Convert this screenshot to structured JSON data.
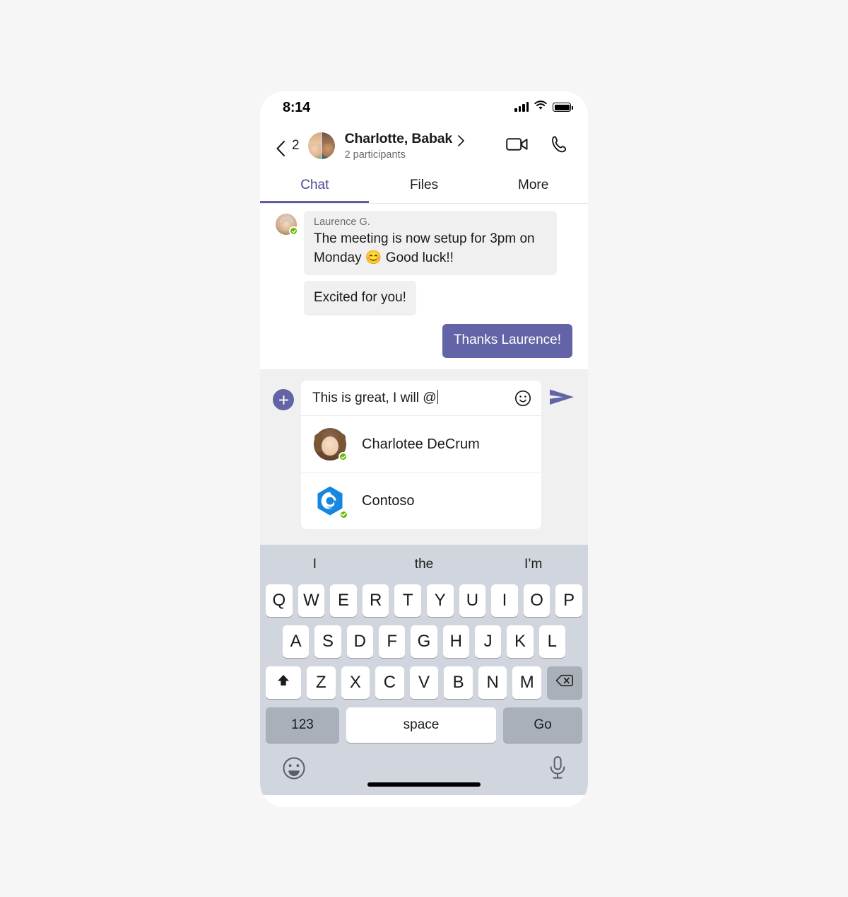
{
  "status_bar": {
    "time": "8:14",
    "signal_icon": "cellular-signal-icon",
    "wifi_icon": "wifi-icon",
    "battery_icon": "battery-full-icon"
  },
  "header": {
    "back_icon": "chevron-left-icon",
    "back_count": "2",
    "avatar_name": "group-avatar",
    "title": "Charlotte, Babak",
    "title_chevron_icon": "chevron-right-icon",
    "subtitle": "2 participants",
    "video_call_icon": "video-camera-icon",
    "audio_call_icon": "phone-icon"
  },
  "tabs": {
    "active_index": 0,
    "items": [
      {
        "label": "Chat"
      },
      {
        "label": "Files"
      },
      {
        "label": "More"
      }
    ]
  },
  "messages": [
    {
      "type": "incoming",
      "sender": "Laurence G.",
      "text": "The meeting is now setup for 3pm on Monday 😊 Good luck!!",
      "avatar": "laurence-avatar",
      "presence": "available"
    },
    {
      "type": "incoming",
      "sender": "",
      "text": "Excited for you!"
    },
    {
      "type": "outgoing",
      "text": "Thanks Laurence!"
    }
  ],
  "compose": {
    "add_icon": "plus-icon",
    "input_value": "This is great, I will @",
    "input_placeholder": "Type a message",
    "emoji_icon": "smiley-face-icon",
    "send_icon": "send-arrow-icon"
  },
  "mention_suggestions": [
    {
      "name": "Charlotee DeCrum",
      "avatar": "charlotee-avatar",
      "presence": "available"
    },
    {
      "name": "Contoso",
      "avatar": "contoso-logo",
      "presence": "available"
    }
  ],
  "keyboard": {
    "predictions": [
      "I",
      "the",
      "I’m"
    ],
    "row1": [
      "Q",
      "W",
      "E",
      "R",
      "T",
      "Y",
      "U",
      "I",
      "O",
      "P"
    ],
    "row2": [
      "A",
      "S",
      "D",
      "F",
      "G",
      "H",
      "J",
      "K",
      "L"
    ],
    "row3": [
      "Z",
      "X",
      "C",
      "V",
      "B",
      "N",
      "M"
    ],
    "shift_icon": "shift-up-arrow-icon",
    "backspace_icon": "backspace-delete-icon",
    "numbers_label": "123",
    "space_label": "space",
    "return_label": "Go",
    "emoji_switch_icon": "emoji-keyboard-icon",
    "dictation_icon": "microphone-icon"
  },
  "colors": {
    "accent_purple": "#6264a7",
    "tab_underline": "#5b5ea6",
    "presence_green": "#6bb700",
    "keyboard_bg": "#d1d5dd",
    "page_bg": "#f6f6f7",
    "contoso_blue": "#0f7ae0"
  }
}
